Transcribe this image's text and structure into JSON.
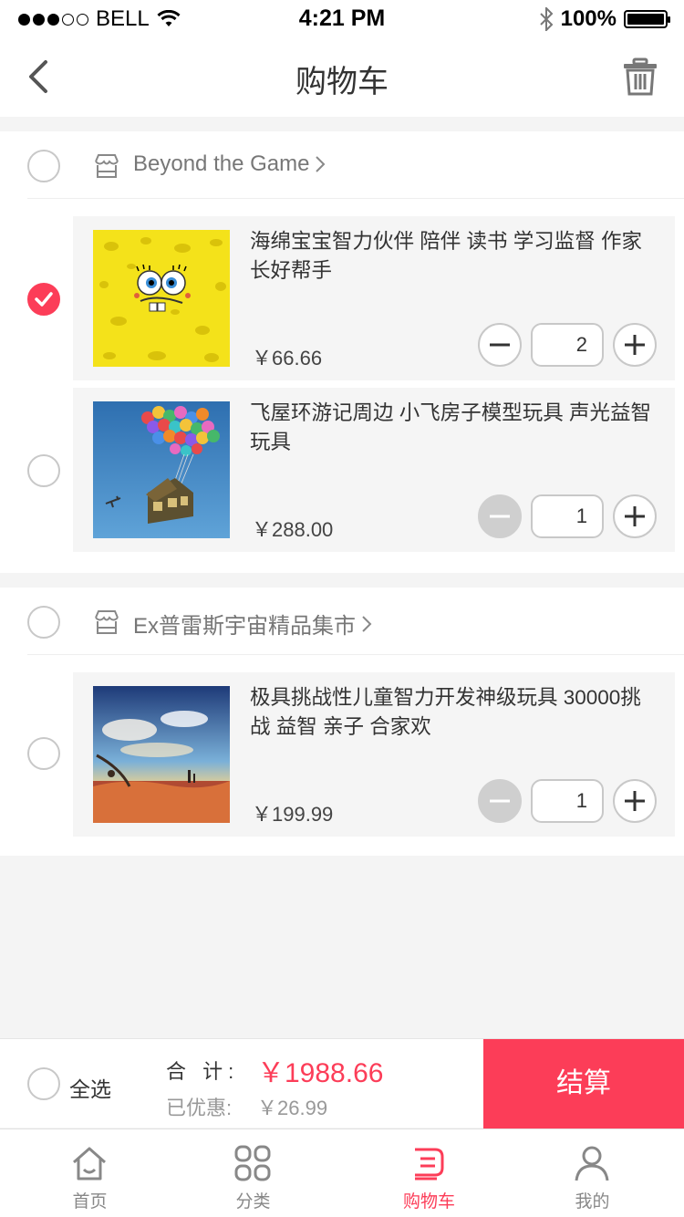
{
  "status_bar": {
    "carrier": "BELL",
    "time": "4:21 PM",
    "battery": "100%"
  },
  "nav": {
    "title": "购物车"
  },
  "shops": [
    {
      "name": "Beyond the Game",
      "checked": false,
      "items": [
        {
          "title": "海绵宝宝智力伙伴  陪伴 读书 学习监督 作家长好帮手",
          "price": "￥66.66",
          "quantity": "2",
          "checked": true,
          "minus_disabled": false
        },
        {
          "title": "飞屋环游记周边  小飞房子模型玩具  声光益智玩具",
          "price": "￥288.00",
          "quantity": "1",
          "checked": false,
          "minus_disabled": true
        }
      ]
    },
    {
      "name": "Ex普雷斯宇宙精品集市",
      "checked": false,
      "items": [
        {
          "title": "极具挑战性儿童智力开发神级玩具  30000挑战  益智  亲子  合家欢",
          "price": "￥199.99",
          "quantity": "1",
          "checked": false,
          "minus_disabled": true
        }
      ]
    }
  ],
  "checkout": {
    "select_all": "全选",
    "total_label": "合 计:",
    "total_value": "￥1988.66",
    "discount_label": "已优惠:",
    "discount_value": "￥26.99",
    "button": "结算"
  },
  "tabs": [
    {
      "label": "首页",
      "icon": "home-icon"
    },
    {
      "label": "分类",
      "icon": "category-icon"
    },
    {
      "label": "购物车",
      "icon": "cart-icon",
      "active": true
    },
    {
      "label": "我的",
      "icon": "profile-icon"
    }
  ],
  "colors": {
    "accent": "#fc3d58",
    "background": "#f4f4f4"
  }
}
